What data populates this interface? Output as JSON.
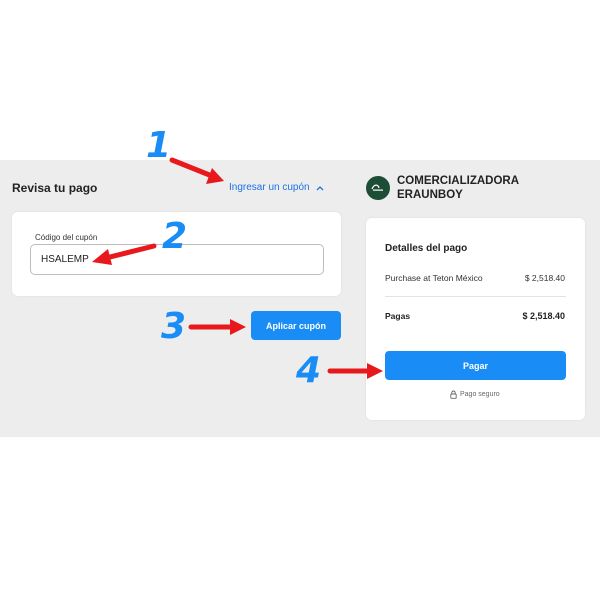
{
  "review": {
    "title": "Revisa tu pago",
    "coupon_toggle_label": "Ingresar un cupón"
  },
  "coupon": {
    "label": "Código del cupón",
    "value": "HSALEMP",
    "apply_label": "Aplicar cupón"
  },
  "merchant": {
    "name": "COMERCIALIZADORA ERAUNBOY",
    "logo_icon": "merchant-logo-icon"
  },
  "payment": {
    "title": "Detalles del pago",
    "purchase_label": "Purchase at Teton México",
    "purchase_amount": "$ 2,518.40",
    "paid_label": "Pagas",
    "paid_amount": "$ 2,518.40",
    "pay_label": "Pagar",
    "secure_label": "Pago seguro"
  },
  "annotations": {
    "steps": [
      "1",
      "2",
      "3",
      "4"
    ],
    "arrow_color": "#e8191c",
    "number_color": "#1a8cf5"
  },
  "colors": {
    "accent": "#1a8cf5",
    "link": "#1a73e8",
    "background_band": "#ededed"
  }
}
